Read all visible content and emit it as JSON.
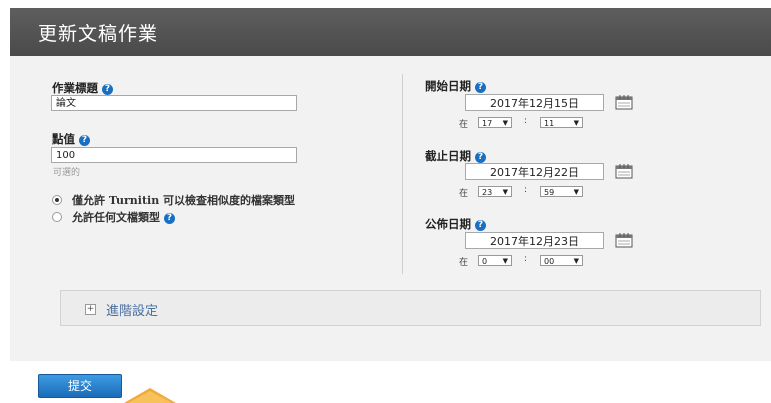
{
  "header": {
    "title": "更新文稿作業"
  },
  "left": {
    "title_label": "作業標題",
    "title_value": "論文",
    "points_label": "點值",
    "points_value": "100",
    "points_hint": "可選的",
    "file_type_options": [
      {
        "label": "僅允許 Turnitin 可以檢查相似度的檔案類型",
        "selected": true
      },
      {
        "label": "允許任何文檔類型",
        "selected": false
      }
    ]
  },
  "right": {
    "start": {
      "label": "開始日期",
      "date": "2017年12月15日",
      "at": "在",
      "hour": "17",
      "minute": "11"
    },
    "due": {
      "label": "截止日期",
      "date": "2017年12月22日",
      "at": "在",
      "hour": "23",
      "minute": "59"
    },
    "post": {
      "label": "公佈日期",
      "date": "2017年12月23日",
      "at": "在",
      "hour": "0",
      "minute": "00"
    }
  },
  "advanced": {
    "label": "進階設定",
    "expand_icon": "plus-box-icon"
  },
  "submit_label": "提交",
  "colors": {
    "header_bg": "#555555",
    "help_icon": "#1a6fc2",
    "submit_bg": "#2a82cf",
    "link": "#4a6fa0"
  },
  "icons": {
    "help": "question-circle-icon",
    "calendar": "calendar-icon"
  }
}
